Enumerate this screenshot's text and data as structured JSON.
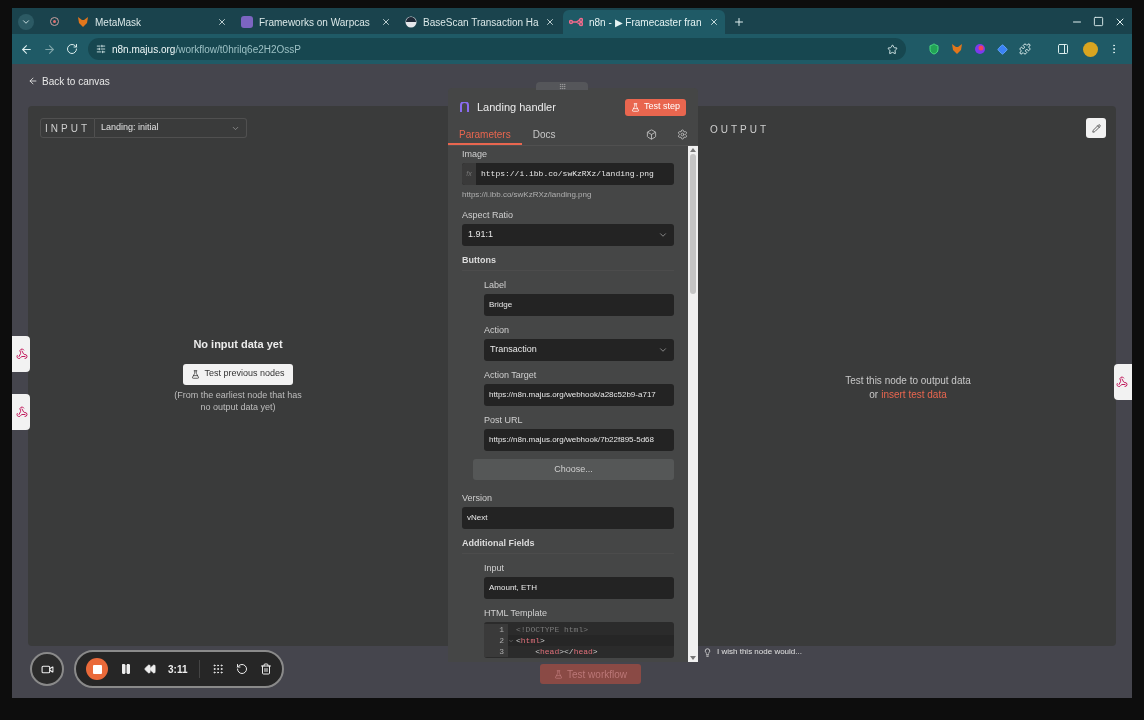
{
  "browser": {
    "tabs": [
      {
        "title": "MetaMask",
        "selected": false
      },
      {
        "title": "Frameworks on Warpcas",
        "selected": false
      },
      {
        "title": "BaseScan Transaction Ha",
        "selected": false
      },
      {
        "title": "n8n - ▶ Framecaster fran",
        "selected": true
      }
    ],
    "url_host": "n8n.majus.org",
    "url_path": "/workflow/t0hrilq6e2H2OssP"
  },
  "back_link": "Back to canvas",
  "input_panel": {
    "label": "INPUT",
    "node_select": "Landing: initial",
    "empty_title": "No input data yet",
    "test_button": "Test previous nodes",
    "hint": "(From the earliest node that has no output data yet)"
  },
  "node_panel": {
    "title": "Landing handler",
    "test_button": "Test step",
    "tabs": [
      {
        "label": "Parameters",
        "selected": true
      },
      {
        "label": "Docs",
        "selected": false
      }
    ],
    "parameters": [
      {
        "kind": "expression",
        "label": "Image",
        "prefix": "fx",
        "value": "https://i.ibb.co/swKzRXz/landing.png",
        "hint": "https://i.ibb.co/swKzRXz/landing.png"
      },
      {
        "kind": "select",
        "label": "Aspect Ratio",
        "value": "1.91:1"
      },
      {
        "kind": "section",
        "label": "Buttons",
        "children": [
          {
            "kind": "text",
            "label": "Label",
            "value": "Bridge"
          },
          {
            "kind": "select",
            "label": "Action",
            "value": "Transaction"
          },
          {
            "kind": "text",
            "label": "Action Target",
            "value": "https://n8n.majus.org/webhook/a28c52b9-a717"
          },
          {
            "kind": "text",
            "label": "Post URL",
            "value": "https://n8n.majus.org/webhook/7b22f895-5d68"
          },
          {
            "kind": "button",
            "label": "Choose..."
          }
        ]
      },
      {
        "kind": "text",
        "label": "Version",
        "value": "vNext"
      },
      {
        "kind": "section",
        "label": "Additional Fields",
        "children": [
          {
            "kind": "text",
            "label": "Input",
            "value": "Amount, ETH"
          },
          {
            "kind": "code",
            "label": "HTML Template",
            "lines": [
              {
                "number": "1",
                "foldable": false,
                "tokens": [
                  {
                    "text": "<!DOCTYPE html>",
                    "kind": "doctype"
                  }
                ]
              },
              {
                "number": "2",
                "foldable": true,
                "tokens": [
                  {
                    "text": "<",
                    "kind": "punct"
                  },
                  {
                    "text": "html",
                    "kind": "tag"
                  },
                  {
                    "text": ">",
                    "kind": "punct"
                  }
                ]
              },
              {
                "number": "3",
                "foldable": false,
                "tokens": [
                  {
                    "text": "    <",
                    "kind": "punct"
                  },
                  {
                    "text": "head",
                    "kind": "tag"
                  },
                  {
                    "text": "></",
                    "kind": "punct"
                  },
                  {
                    "text": "head",
                    "kind": "tag"
                  },
                  {
                    "text": ">",
                    "kind": "punct"
                  }
                ]
              }
            ]
          }
        ]
      }
    ]
  },
  "output_panel": {
    "label": "OUTPUT",
    "message": "Test this node to output data",
    "message_prefix": "or",
    "link": "insert test data"
  },
  "feedback": "I wish this node would...",
  "test_workflow": "Test workflow",
  "recorder": {
    "time": "3:11"
  }
}
